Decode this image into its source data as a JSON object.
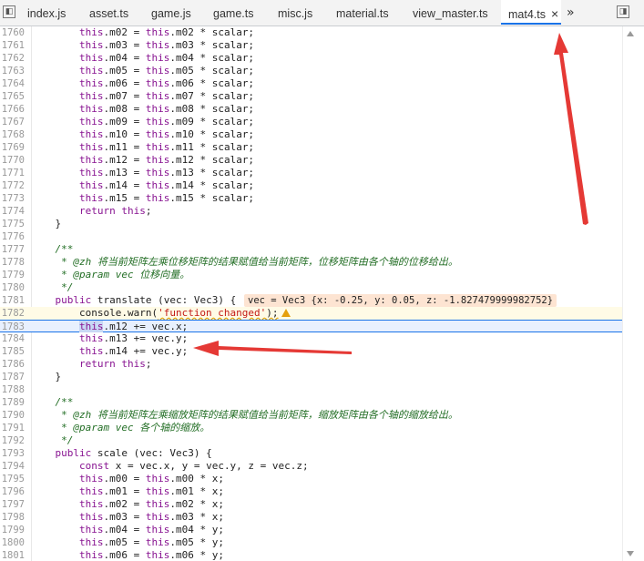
{
  "tabs": [
    {
      "label": "index.js"
    },
    {
      "label": "asset.ts"
    },
    {
      "label": "game.js"
    },
    {
      "label": "game.ts"
    },
    {
      "label": "misc.js"
    },
    {
      "label": "material.ts"
    },
    {
      "label": "view_master.ts"
    },
    {
      "label": "mat4.ts",
      "active": true,
      "close": "×"
    }
  ],
  "overflow_label": "»",
  "value_tooltip": "vec = Vec3 {x: -0.25, y: 0.05, z: -1.827479999982752}",
  "lines": [
    {
      "n": "1760",
      "code": "        this.m02 = this.m02 * scalar;"
    },
    {
      "n": "1761",
      "code": "        this.m03 = this.m03 * scalar;"
    },
    {
      "n": "1762",
      "code": "        this.m04 = this.m04 * scalar;"
    },
    {
      "n": "1763",
      "code": "        this.m05 = this.m05 * scalar;"
    },
    {
      "n": "1764",
      "code": "        this.m06 = this.m06 * scalar;"
    },
    {
      "n": "1765",
      "code": "        this.m07 = this.m07 * scalar;"
    },
    {
      "n": "1766",
      "code": "        this.m08 = this.m08 * scalar;"
    },
    {
      "n": "1767",
      "code": "        this.m09 = this.m09 * scalar;"
    },
    {
      "n": "1768",
      "code": "        this.m10 = this.m10 * scalar;"
    },
    {
      "n": "1769",
      "code": "        this.m11 = this.m11 * scalar;"
    },
    {
      "n": "1770",
      "code": "        this.m12 = this.m12 * scalar;"
    },
    {
      "n": "1771",
      "code": "        this.m13 = this.m13 * scalar;"
    },
    {
      "n": "1772",
      "code": "        this.m14 = this.m14 * scalar;"
    },
    {
      "n": "1773",
      "code": "        this.m15 = this.m15 * scalar;"
    },
    {
      "n": "1774",
      "code": "        return this;"
    },
    {
      "n": "1775",
      "code": "    }"
    },
    {
      "n": "1776",
      "code": ""
    },
    {
      "n": "1777",
      "code": "    /**"
    },
    {
      "n": "1778",
      "code": "     * @zh 将当前矩阵左乘位移矩阵的结果赋值给当前矩阵，位移矩阵由各个轴的位移给出。"
    },
    {
      "n": "1779",
      "code": "     * @param vec 位移向量。"
    },
    {
      "n": "1780",
      "code": "     */"
    },
    {
      "n": "1781",
      "code": "    public translate (vec: Vec3) {"
    },
    {
      "n": "1782",
      "code": "        console.warn('function changed');"
    },
    {
      "n": "1783",
      "code": "        this.m12 += vec.x;"
    },
    {
      "n": "1784",
      "code": "        this.m13 += vec.y;"
    },
    {
      "n": "1785",
      "code": "        this.m14 += vec.y;"
    },
    {
      "n": "1786",
      "code": "        return this;"
    },
    {
      "n": "1787",
      "code": "    }"
    },
    {
      "n": "1788",
      "code": ""
    },
    {
      "n": "1789",
      "code": "    /**"
    },
    {
      "n": "1790",
      "code": "     * @zh 将当前矩阵左乘缩放矩阵的结果赋值给当前矩阵，缩放矩阵由各个轴的缩放给出。"
    },
    {
      "n": "1791",
      "code": "     * @param vec 各个轴的缩放。"
    },
    {
      "n": "1792",
      "code": "     */"
    },
    {
      "n": "1793",
      "code": "    public scale (vec: Vec3) {"
    },
    {
      "n": "1794",
      "code": "        const x = vec.x, y = vec.y, z = vec.z;"
    },
    {
      "n": "1795",
      "code": "        this.m00 = this.m00 * x;"
    },
    {
      "n": "1796",
      "code": "        this.m01 = this.m01 * x;"
    },
    {
      "n": "1797",
      "code": "        this.m02 = this.m02 * x;"
    },
    {
      "n": "1798",
      "code": "        this.m03 = this.m03 * x;"
    },
    {
      "n": "1799",
      "code": "        this.m04 = this.m04 * y;"
    },
    {
      "n": "1800",
      "code": "        this.m05 = this.m05 * y;"
    },
    {
      "n": "1801",
      "code": "        this.m06 = this.m06 * y;"
    }
  ],
  "colors": {
    "accent": "#1a73e8",
    "annotation_arrow": "#e53935",
    "warning": "#e5a00d"
  }
}
